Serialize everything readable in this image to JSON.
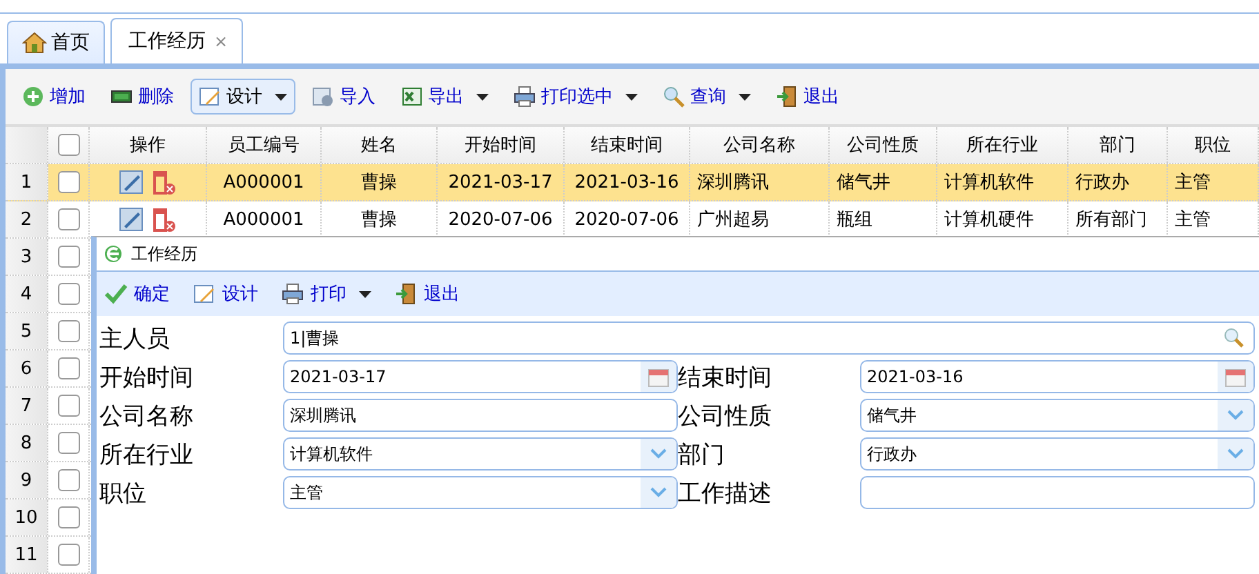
{
  "tabs": [
    {
      "label": "首页",
      "selected": false,
      "closable": false
    },
    {
      "label": "工作经历",
      "selected": true,
      "closable": true,
      "close": "×"
    }
  ],
  "toolbar": [
    {
      "label": "增加",
      "dropdown": false,
      "hover": false
    },
    {
      "label": "删除",
      "dropdown": false,
      "hover": false
    },
    {
      "label": "设计",
      "dropdown": true,
      "hover": true
    },
    {
      "label": "导入",
      "dropdown": false,
      "hover": false
    },
    {
      "label": "导出",
      "dropdown": true,
      "hover": false
    },
    {
      "label": "打印选中",
      "dropdown": true,
      "hover": false
    },
    {
      "label": "查询",
      "dropdown": true,
      "hover": false
    },
    {
      "label": "退出",
      "dropdown": false,
      "hover": false
    }
  ],
  "grid": {
    "columns": [
      "操作",
      "员工编号",
      "姓名",
      "开始时间",
      "结束时间",
      "公司名称",
      "公司性质",
      "所在行业",
      "部门",
      "职位"
    ],
    "header_checked": false,
    "rows": [
      {
        "number": "1",
        "checked": false,
        "selected": true,
        "cells": [
          "A000001",
          "曹操",
          "2021-03-17",
          "2021-03-16",
          "深圳腾讯",
          "储气井",
          "计算机软件",
          "行政办",
          "主管"
        ]
      },
      {
        "number": "2",
        "checked": false,
        "selected": false,
        "cells": [
          "A000001",
          "曹操",
          "2020-07-06",
          "2020-07-06",
          "广州超易",
          "瓶组",
          "计算机硬件",
          "所有部门",
          "主管"
        ]
      },
      {
        "number": "3",
        "checked": false,
        "selected": false
      },
      {
        "number": "4",
        "checked": false,
        "selected": false
      },
      {
        "number": "5",
        "checked": false,
        "selected": false
      },
      {
        "number": "6",
        "checked": false,
        "selected": false
      },
      {
        "number": "7",
        "checked": false,
        "selected": false
      },
      {
        "number": "8",
        "checked": false,
        "selected": false
      },
      {
        "number": "9",
        "checked": false,
        "selected": false
      },
      {
        "number": "10",
        "checked": false,
        "selected": false
      },
      {
        "number": "11",
        "checked": false,
        "selected": false
      }
    ]
  },
  "dialog": {
    "title": "工作经历",
    "toolbar": [
      {
        "label": "确定",
        "dropdown": false
      },
      {
        "label": "设计",
        "dropdown": false
      },
      {
        "label": "打印",
        "dropdown": true
      },
      {
        "label": "退出",
        "dropdown": false
      }
    ],
    "fields": [
      {
        "label": "主人员",
        "value": "1|曹操",
        "kind": "lookup"
      },
      {
        "label": "开始时间",
        "value": "2021-03-17",
        "kind": "date"
      },
      {
        "label": "结束时间",
        "value": "2021-03-16",
        "kind": "date"
      },
      {
        "label": "公司名称",
        "value": "深圳腾讯",
        "kind": "text"
      },
      {
        "label": "公司性质",
        "value": "储气井",
        "kind": "select"
      },
      {
        "label": "所在行业",
        "value": "计算机软件",
        "kind": "select"
      },
      {
        "label": "部门",
        "value": "行政办",
        "kind": "select"
      },
      {
        "label": "职位",
        "value": "主管",
        "kind": "select"
      },
      {
        "label": "工作描述",
        "kind": "text"
      }
    ]
  }
}
